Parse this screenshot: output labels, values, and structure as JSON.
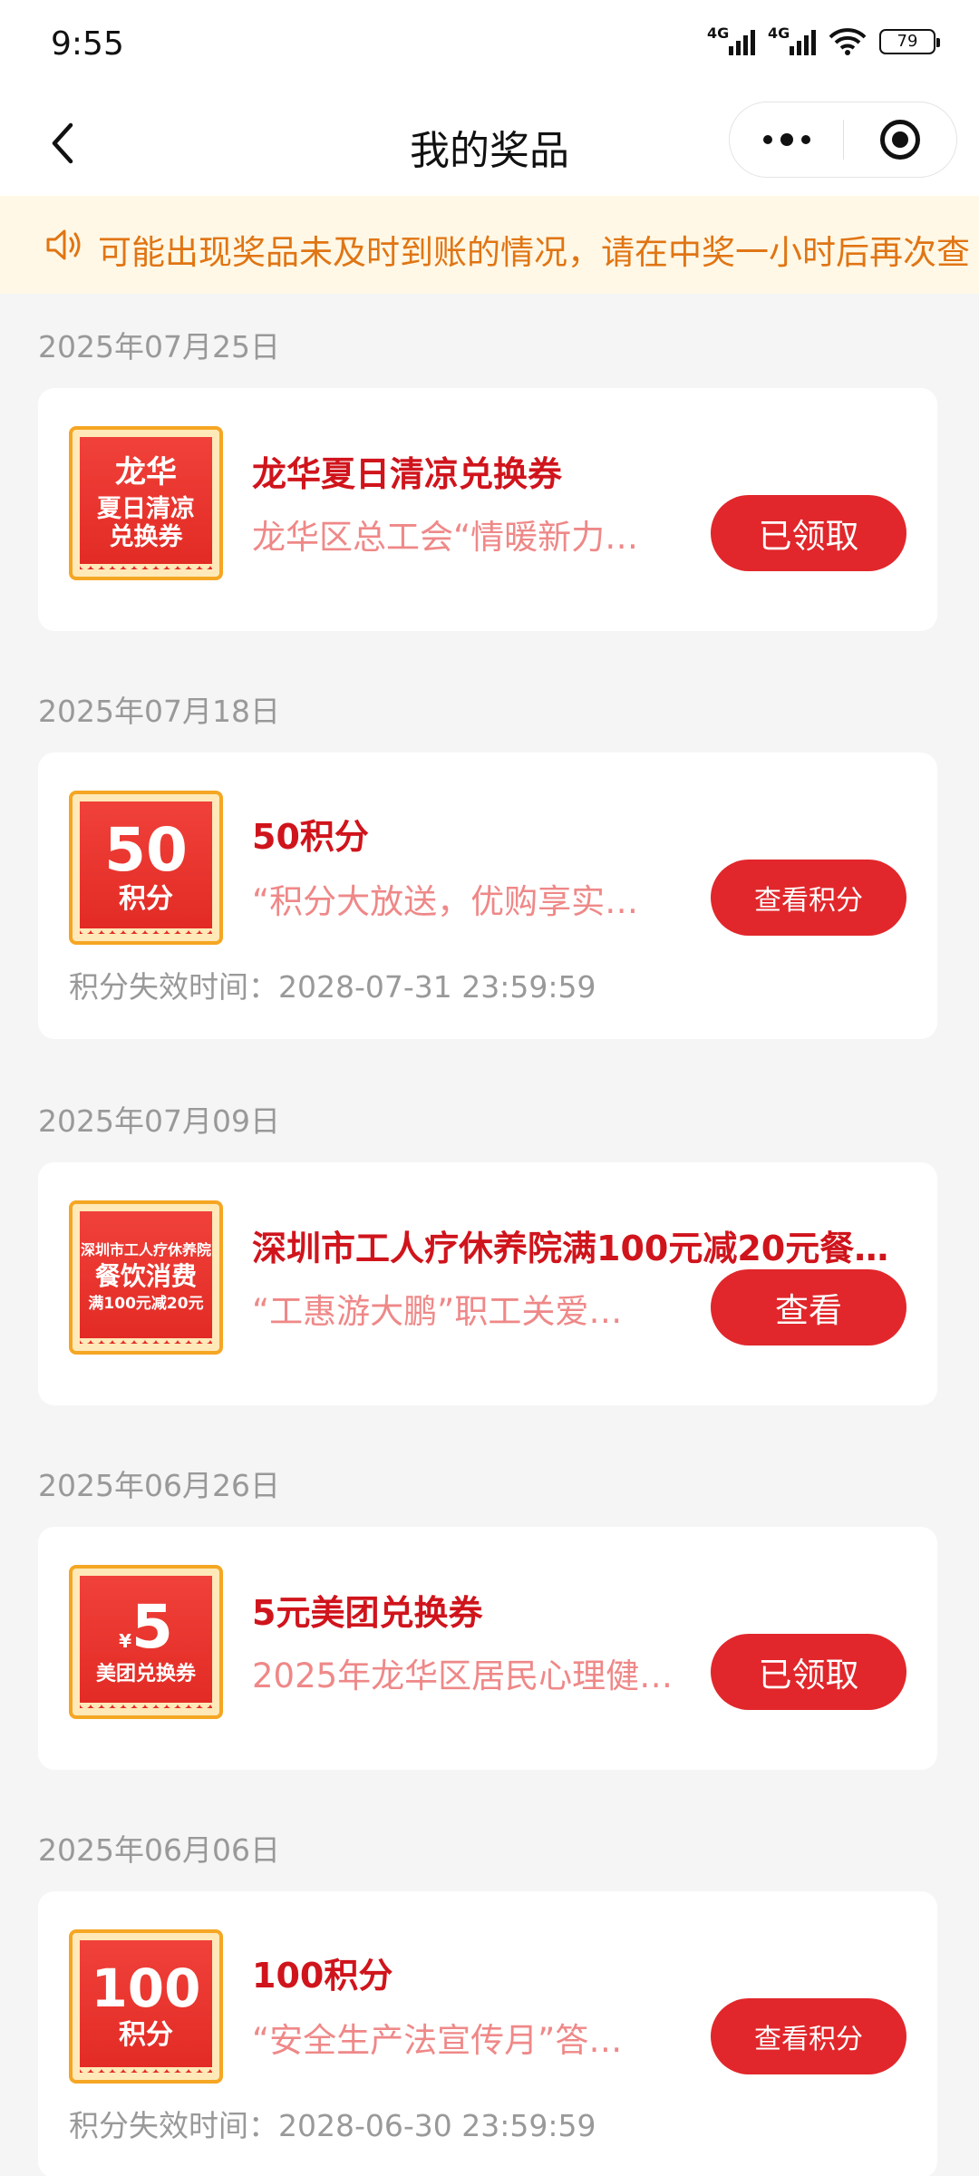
{
  "status_bar": {
    "time": "9:55",
    "network1": "4G",
    "network2": "4G",
    "battery": "79"
  },
  "nav": {
    "title": "我的奖品"
  },
  "notice": {
    "text": "可能出现奖品未及时到账的情况，请在中奖一小时后再次查"
  },
  "prizes": [
    {
      "date": "2025年07月25日",
      "thumb_lines": [
        "龙华",
        "夏日清凉",
        "兑换券"
      ],
      "title": "龙华夏日清凉兑换券",
      "desc": "龙华区总工会“情暖新力…",
      "button": "已领取"
    },
    {
      "date": "2025年07月18日",
      "thumb_lines": [
        "50",
        "积分"
      ],
      "title": "50积分",
      "desc": "“积分大放送，优购享实…",
      "button": "查看积分",
      "expire": "积分失效时间：2028-07-31 23:59:59"
    },
    {
      "date": "2025年07月09日",
      "thumb_lines": [
        "深圳市工人疗休养院",
        "餐饮消费",
        "满100元减20元"
      ],
      "title": "深圳市工人疗休养院满100元减20元餐…",
      "desc": "“工惠游大鹏”职工关爱…",
      "button": "查看"
    },
    {
      "date": "2025年06月26日",
      "thumb_lines": [
        "¥",
        "5",
        "美团兑换券"
      ],
      "title": "5元美团兑换券",
      "desc": "2025年龙华区居民心理健…",
      "button": "已领取"
    },
    {
      "date": "2025年06月06日",
      "thumb_lines": [
        "100",
        "积分"
      ],
      "title": "100积分",
      "desc": "“安全生产法宣传月”答…",
      "button": "查看积分",
      "expire": "积分失效时间：2028-06-30 23:59:59"
    }
  ]
}
